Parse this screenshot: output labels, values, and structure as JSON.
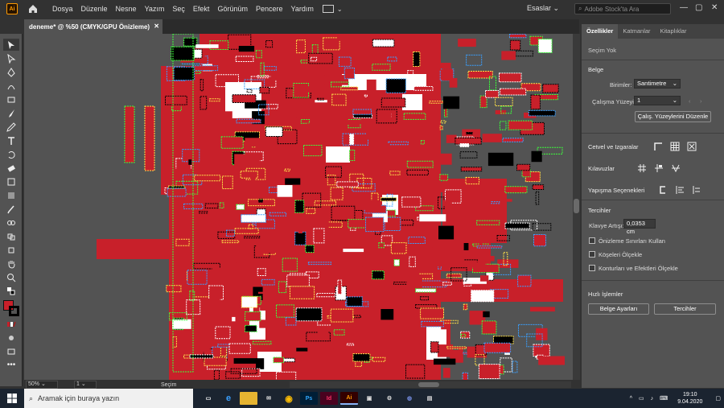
{
  "app": {
    "logo": "Ai"
  },
  "menu": [
    "Dosya",
    "Düzenle",
    "Nesne",
    "Yazım",
    "Seç",
    "Efekt",
    "Görünüm",
    "Pencere",
    "Yardım"
  ],
  "workspace": "Esaslar",
  "search_placeholder": "Adobe Stock'ta Ara",
  "document_tab": "deneme* @ %50 (CMYK/GPU Önizleme)",
  "status": {
    "zoom": "50%",
    "artboard": "1",
    "tool": "Seçim"
  },
  "panel": {
    "tabs": [
      "Özellikler",
      "Katmanlar",
      "Kitaplıklar"
    ],
    "selection": "Seçim Yok",
    "document_header": "Belge",
    "units_label": "Birimler:",
    "units_value": "Santimetre",
    "artboard_label": "Çalışma Yüzeyi:",
    "artboard_value": "1",
    "edit_artboards_button": "Çalış. Yüzeylerini Düzenle",
    "rulers_label": "Cetvel ve Izgaralar",
    "guides_label": "Kılavuzlar",
    "snap_label": "Yapışma Seçenekleri",
    "prefs_header": "Tercihler",
    "keyboard_increment_label": "Klavye Artışı:",
    "keyboard_increment_value": "0,0353 cm",
    "check1": "Önizleme Sınırları Kullan",
    "check2": "Köşeleri Ölçekle",
    "check3": "Konturları ve Efektleri Ölçekle",
    "quick_actions": "Hızlı İşlemler",
    "doc_settings_button": "Belge Ayarları",
    "prefs_button": "Tercihler"
  },
  "taskbar": {
    "search": "Aramak için buraya yazın",
    "time": "19:10",
    "date": "9.04.2020"
  },
  "colors": {
    "fill": "#c8202a",
    "canvas": "#535353",
    "ui": "#323232",
    "accent": "#ff9a00"
  }
}
